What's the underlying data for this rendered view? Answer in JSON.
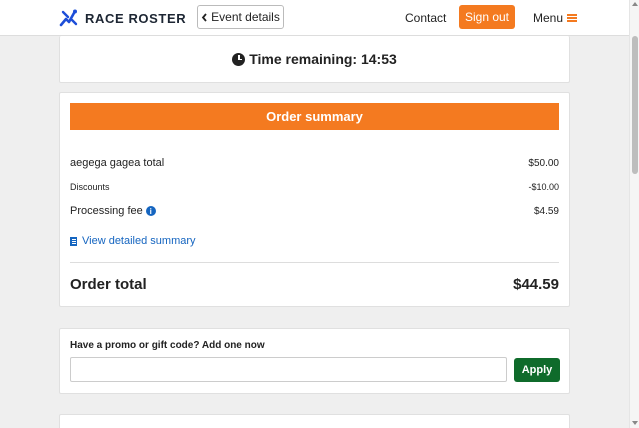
{
  "header": {
    "logo_text": "RACE ROSTER",
    "event_details_label": "Event details",
    "contact_label": "Contact",
    "signout_label": "Sign out",
    "menu_label": "Menu"
  },
  "timer": {
    "label": "Time remaining: 14:53"
  },
  "summary": {
    "title": "Order summary",
    "lines": [
      {
        "label": "aegega gagea total",
        "value": "$50.00"
      },
      {
        "label": "Discounts",
        "value": "-$10.00"
      },
      {
        "label": "Processing fee",
        "value": "$4.59"
      }
    ],
    "detail_link": "View detailed summary",
    "total_label": "Order total",
    "total_value": "$44.59"
  },
  "promo": {
    "title": "Have a promo or gift code? Add one now",
    "input_value": "",
    "input_placeholder": "",
    "apply_label": "Apply"
  },
  "colors": {
    "brand_orange": "#f47a20",
    "apply_green": "#0f6b2b",
    "link_blue": "#1565c0"
  },
  "icons": [
    "logo-runner-icon",
    "chevron-left-icon",
    "hamburger-icon",
    "clock-icon",
    "info-icon",
    "document-icon"
  ]
}
